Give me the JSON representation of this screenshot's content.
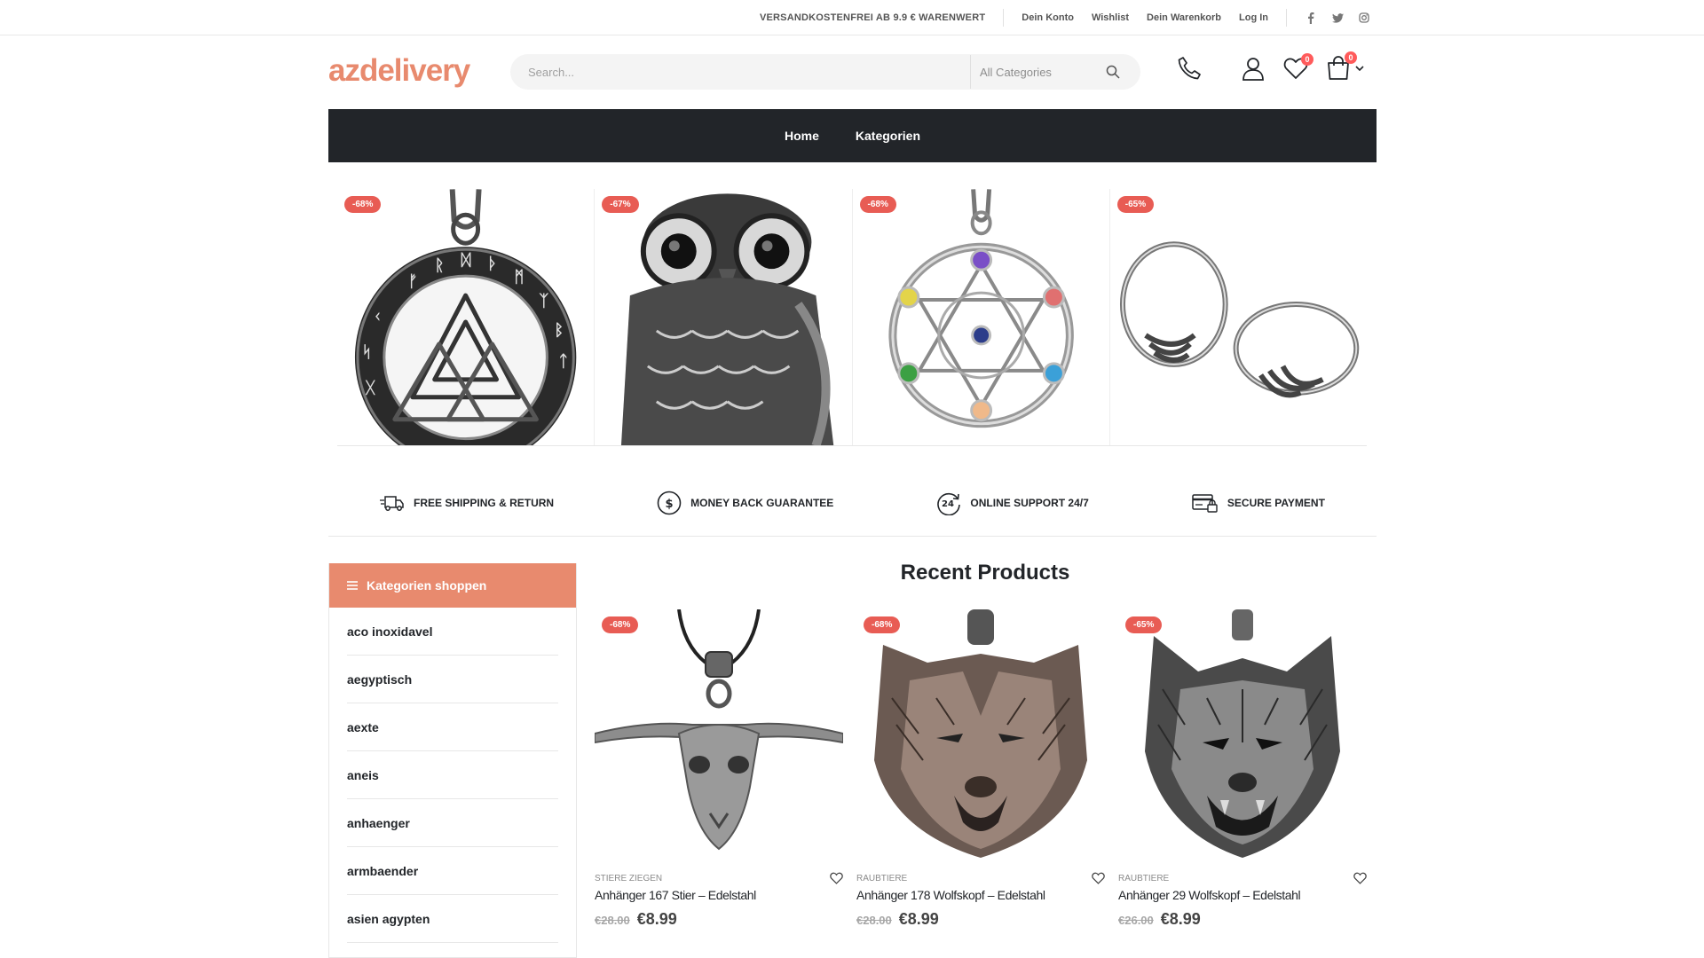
{
  "topbar": {
    "promo": "VERSANDKOSTENFREI AB 9.9 € WARENWERT",
    "links": [
      "Dein Konto",
      "Wishlist",
      "Dein Warenkorb",
      "Log In"
    ]
  },
  "header": {
    "logo": "azdelivery",
    "search_placeholder": "Search...",
    "category_select": "All Categories",
    "wishlist_count": "0",
    "cart_count": "0"
  },
  "nav": {
    "items": [
      "Home",
      "Kategorien"
    ]
  },
  "banners": [
    {
      "discount": "-68%",
      "icon": "rune-pendant"
    },
    {
      "discount": "-67%",
      "icon": "owl-pendant"
    },
    {
      "discount": "-68%",
      "icon": "star-pendant"
    },
    {
      "discount": "-65%",
      "icon": "earrings"
    }
  ],
  "features": [
    {
      "label": "FREE SHIPPING & RETURN",
      "icon": "truck-icon"
    },
    {
      "label": "MONEY BACK GUARANTEE",
      "icon": "dollar-icon"
    },
    {
      "label": "ONLINE SUPPORT 24/7",
      "icon": "support-24-icon"
    },
    {
      "label": "SECURE PAYMENT",
      "icon": "card-lock-icon"
    }
  ],
  "sidebar": {
    "title": "Kategorien shoppen",
    "items": [
      "aco inoxidavel",
      "aegyptisch",
      "aexte",
      "aneis",
      "anhaenger",
      "armbaender",
      "asien agypten"
    ]
  },
  "recent": {
    "title": "Recent Products",
    "products": [
      {
        "discount": "-68%",
        "category": "STIERE ZIEGEN",
        "name": "Anhänger 167 Stier – Edelstahl",
        "old_price": "€28.00",
        "price": "€8.99"
      },
      {
        "discount": "-68%",
        "category": "RAUBTIERE",
        "name": "Anhänger 178 Wolfskopf – Edelstahl",
        "old_price": "€28.00",
        "price": "€8.99"
      },
      {
        "discount": "-65%",
        "category": "RAUBTIERE",
        "name": "Anhänger 29 Wolfskopf – Edelstahl",
        "old_price": "€26.00",
        "price": "€8.99"
      }
    ]
  },
  "colors": {
    "accent": "#e88a6e",
    "nav_bg": "#222529",
    "badge": "#e85c54"
  }
}
